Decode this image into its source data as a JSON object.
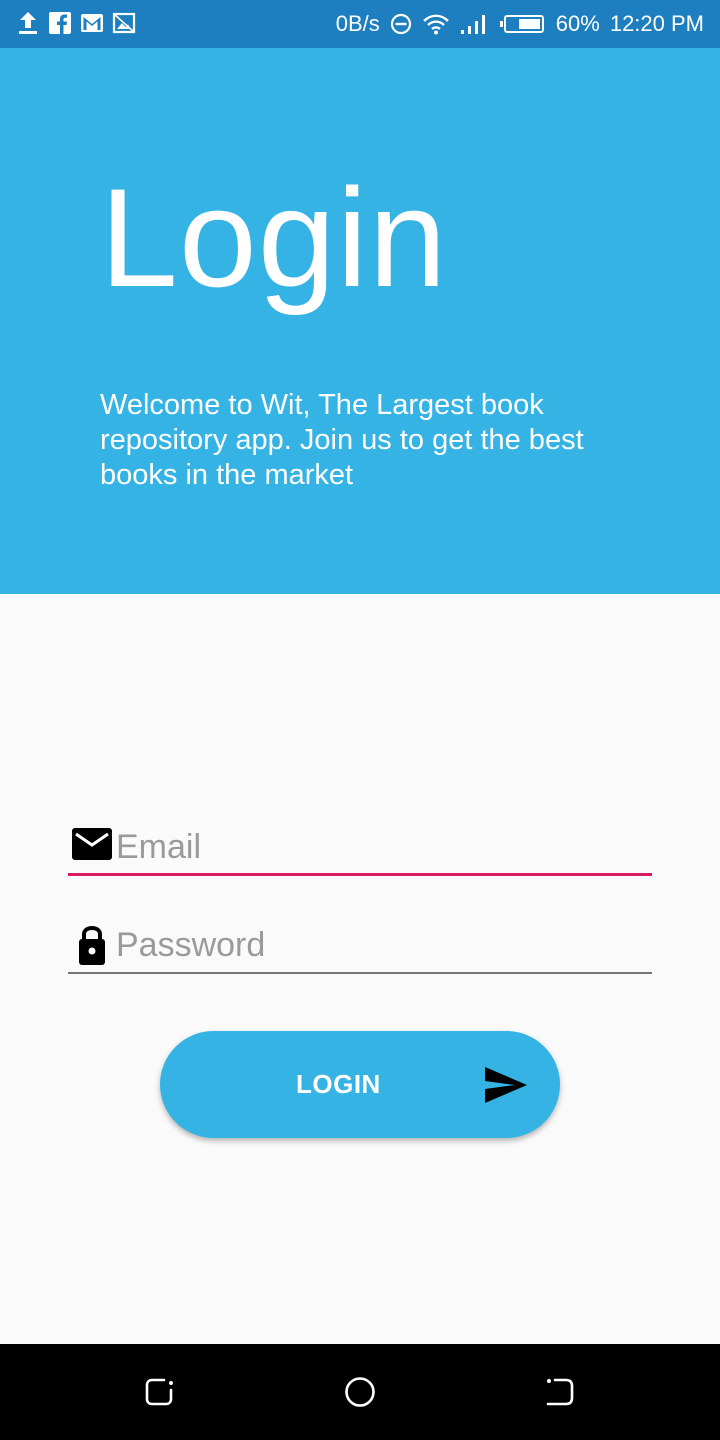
{
  "status_bar": {
    "network_speed": "0B/s",
    "battery": "60%",
    "time": "12:20 PM",
    "left_icons": [
      "upload-icon",
      "facebook-icon",
      "gmail-icon",
      "gallery-icon"
    ],
    "right_icons": [
      "dnd-icon",
      "wifi-icon",
      "signal-icon",
      "battery-icon"
    ]
  },
  "header": {
    "title": "Login",
    "welcome_text": "Welcome to Wit, The Largest book repository app. Join us to get the best books in the market",
    "background_color": "#34b3e4"
  },
  "form": {
    "email": {
      "placeholder": "Email",
      "value": "",
      "icon": "mail-icon",
      "underline_color": "#d81b60"
    },
    "password": {
      "placeholder": "Password",
      "value": "",
      "icon": "lock-icon"
    },
    "login_button": {
      "label": "LOGIN",
      "icon": "send-icon"
    }
  },
  "nav_bar": {
    "buttons": [
      "recents-icon",
      "home-icon",
      "back-icon"
    ]
  },
  "colors": {
    "accent": "#34b3e4",
    "status_bar": "#1d7fbf",
    "error_pink": "#d81b60"
  }
}
